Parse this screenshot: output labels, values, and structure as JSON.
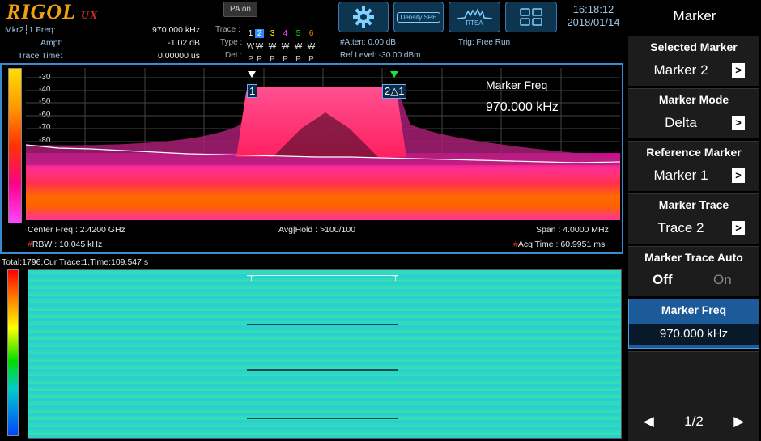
{
  "header": {
    "logo": "RIGOL",
    "logo_sub": "UX",
    "pa_label": "PA on",
    "marker_info": [
      {
        "label": "Mkr2┆1 Freq:",
        "value": "970.000 kHz"
      },
      {
        "label": "Ampt:",
        "value": "-1.02 dB"
      },
      {
        "label": "Trace Time:",
        "value": "0.00000 us"
      }
    ],
    "trace_rows": {
      "trace_label": "Trace :",
      "type_label": "Type :",
      "det_label": "Det :",
      "trace_nums": [
        "1",
        "2",
        "3",
        "4",
        "5",
        "6"
      ],
      "trace_colors": [
        "#ffffff",
        "#2a8cff",
        "#ffff00",
        "#ff44ff",
        "#00ee00",
        "#ff8800"
      ],
      "types": [
        "W",
        "W",
        "W",
        "W",
        "W",
        "W"
      ],
      "dets": [
        "P",
        "P",
        "P",
        "P",
        "P",
        "P"
      ]
    },
    "atten": "#Atten: 0.00 dB",
    "ref_level": "Ref Level: -30.00 dBm",
    "trig": "Trig: Free Run",
    "mode_buttons": [
      "Density SPE",
      "RTSA"
    ],
    "time": "16:18:12",
    "date": "2018/01/14",
    "icons": {
      "settings": "gear-icon",
      "layout": "grid-layout-icon",
      "rtsa": "spectrum-icon"
    }
  },
  "spectrum": {
    "y_ticks": [
      "-30",
      "-40",
      "-50",
      "-60",
      "-70",
      "-80"
    ],
    "marker_freq_title": "Marker Freq",
    "marker_freq_value": "970.000 kHz",
    "marker1_label": "1",
    "marker2_label": "2△1",
    "center_freq": "Center Freq : 2.4200 GHz",
    "avg_hold": "Avg|Hold : >100/100",
    "span": "Span : 4.0000 MHz",
    "rbw_prefix": "#",
    "rbw": "RBW : 10.045 kHz",
    "acq_prefix": "#",
    "acq_time": "Acq Time : 60.9951 ms"
  },
  "waterfall": {
    "title": "Total:1796,Cur Trace:1,Time:109.547 s"
  },
  "menu": {
    "title": "Marker",
    "items": [
      {
        "label": "Selected Marker",
        "value": "Marker 2"
      },
      {
        "label": "Marker Mode",
        "value": "Delta"
      },
      {
        "label": "Reference Marker",
        "value": "Marker 1"
      },
      {
        "label": "Marker Trace",
        "value": "Trace 2"
      }
    ],
    "trace_auto": {
      "label": "Marker Trace Auto",
      "off": "Off",
      "on": "On"
    },
    "active": {
      "label": "Marker Freq",
      "value": "970.000 kHz"
    },
    "page": "1/2"
  },
  "colors": {
    "accent": "#3b8bd0",
    "marker_panel": "#1d5a9a",
    "logo": "#f0a010"
  }
}
